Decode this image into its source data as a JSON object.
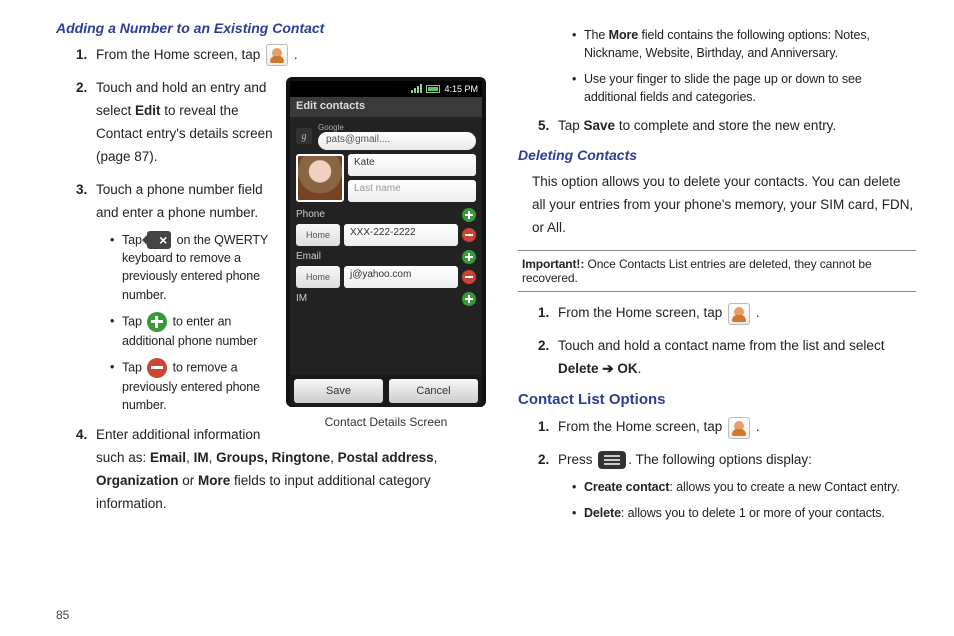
{
  "left": {
    "heading": "Adding a Number to an Existing Contact",
    "step1_pre": "From the Home screen, tap ",
    "step1_post": " .",
    "step2_a": "Touch and hold an entry and select ",
    "step2_b": "Edit",
    "step2_c": " to reveal the Contact entry's details screen (page 87).",
    "step3": "Touch a phone number field and enter a phone number.",
    "b1_a": "Tap ",
    "b1_b": " on the QWERTY keyboard to remove a previously entered phone number.",
    "b2_a": "Tap ",
    "b2_b": " to enter an additional phone number",
    "b3_a": "Tap ",
    "b3_b": " to remove a previously entered phone number.",
    "step4_a": "Enter additional information such as: ",
    "step4_email": "Email",
    "step4_im": "IM",
    "step4_groups": "Groups, Ringtone",
    "step4_postal": "Postal address",
    "step4_org": "Organization",
    "step4_more": "More",
    "step4_end": " fields to input additional category information.",
    "caption": "Contact Details Screen"
  },
  "mock": {
    "time": "4:15 PM",
    "title": "Edit contacts",
    "provider": "Google",
    "email_acct": "pats@gmail....",
    "first": "Kate",
    "last_ph": "Last name",
    "sec_phone": "Phone",
    "type_home": "Home",
    "phone_val": "XXX-222-2222",
    "sec_email": "Email",
    "email_val": "j@yahoo.com",
    "sec_im": "IM",
    "save": "Save",
    "cancel": "Cancel"
  },
  "right": {
    "more_a": "The ",
    "more_b": "More",
    "more_c": " field contains the following options: Notes, Nickname, Website, Birthday, and Anniversary.",
    "slide": "Use your finger to slide the page up or down to see additional fields and categories.",
    "step5_a": "Tap ",
    "step5_b": "Save",
    "step5_c": " to complete and store the new entry.",
    "del_head": "Deleting Contacts",
    "del_intro": "This option allows you to delete your contacts. You can delete all your entries from your phone's memory, your SIM card, FDN, or All.",
    "important_label": "Important!:",
    "important_text": " Once Contacts List entries are deleted, they cannot be recovered.",
    "d1_pre": "From the Home screen, tap ",
    "d1_post": " .",
    "d2_a": "Touch and hold a contact name from the list and select ",
    "d2_b": "Delete",
    "d2_arrow": " ➔ ",
    "d2_c": "OK",
    "d2_d": ".",
    "opt_head": "Contact List Options",
    "o1_pre": "From the Home screen, tap ",
    "o1_post": " .",
    "o2_a": "Press ",
    "o2_b": ". The following options display:",
    "ob1_a": "Create contact",
    "ob1_b": ": allows you to create a new Contact entry.",
    "ob2_a": "Delete",
    "ob2_b": ": allows you to delete 1 or more of your contacts."
  },
  "page": "85"
}
